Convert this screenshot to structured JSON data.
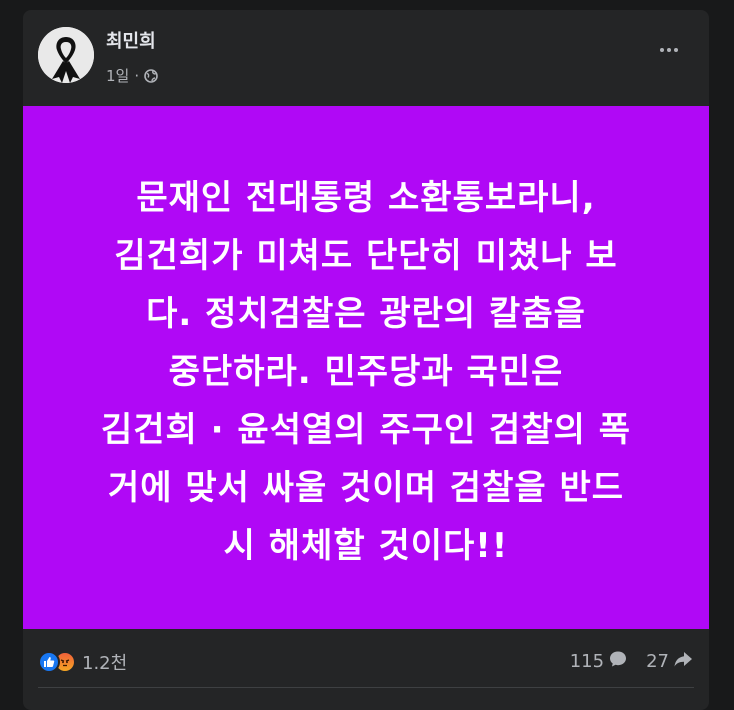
{
  "post": {
    "author": "최민희",
    "time": "1일",
    "separator": "·",
    "text_lines": [
      "문재인 전대통령 소환통보라니,",
      "김건희가 미쳐도 단단히 미쳤나 보",
      "다. 정치검찰은 광란의 칼춤을",
      "중단하라. 민주당과 국민은",
      "김건희 · 윤석열의 주구인 검찰의 폭",
      "거에 맞서 싸울 것이며 검찰을 반드",
      "시 해체할 것이다!!"
    ],
    "background_color": "#b008f6"
  },
  "footer": {
    "reaction_count": "1.2천",
    "comment_count": "115",
    "share_count": "27"
  },
  "icons": {
    "avatar": "mourning-ribbon-icon",
    "privacy": "globe-icon",
    "more": "more-options-icon",
    "like": "like-icon",
    "angry": "angry-icon",
    "comment": "comment-icon",
    "share": "share-icon"
  }
}
